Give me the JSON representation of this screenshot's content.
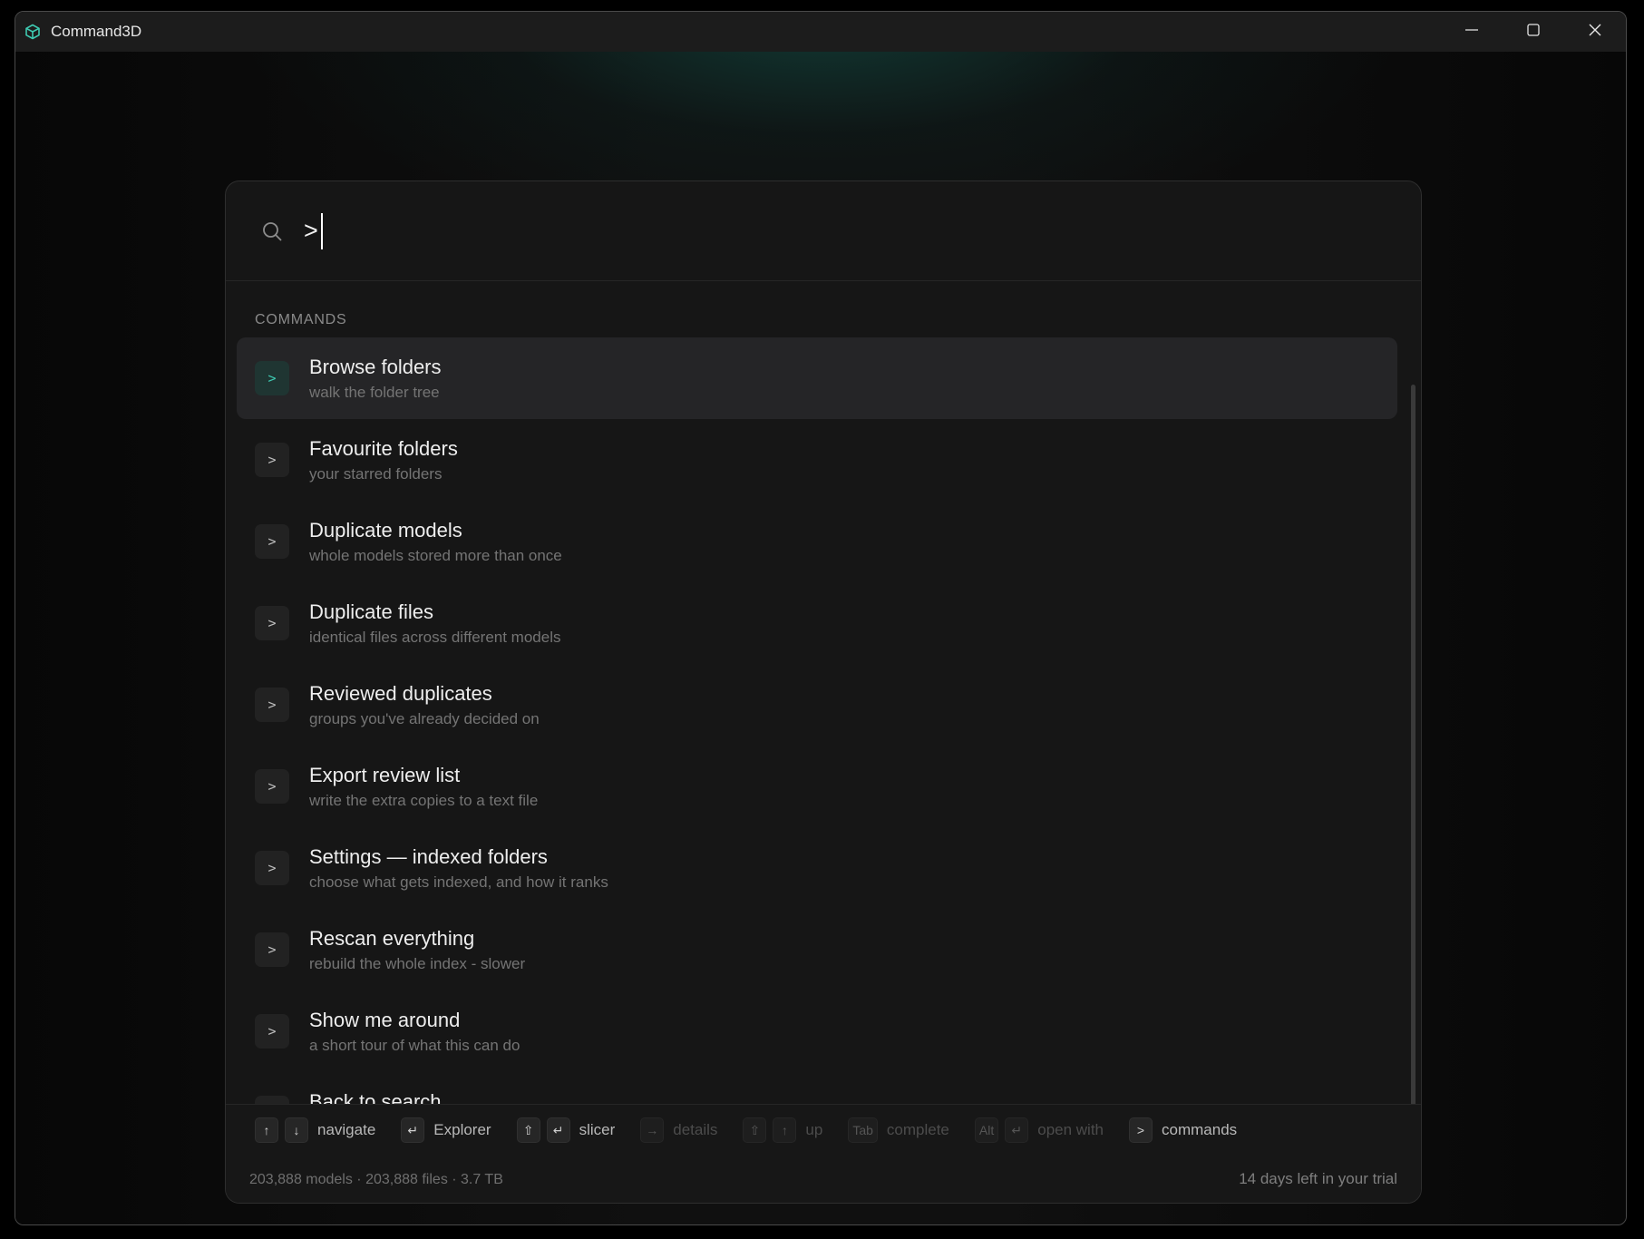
{
  "window": {
    "title": "Command3D",
    "app_icon": "cube-icon",
    "controls": [
      "minimize-icon",
      "maximize-icon",
      "close-icon"
    ],
    "accent_color": "#3ec9b1"
  },
  "search": {
    "value": ">",
    "icon": "search-icon"
  },
  "commands": {
    "section_label": "COMMANDS",
    "badge_glyph": ">",
    "items": [
      {
        "title": "Browse folders",
        "subtitle": "walk the folder tree",
        "active": true
      },
      {
        "title": "Favourite folders",
        "subtitle": "your starred folders"
      },
      {
        "title": "Duplicate models",
        "subtitle": "whole models stored more than once"
      },
      {
        "title": "Duplicate files",
        "subtitle": "identical files across different models"
      },
      {
        "title": "Reviewed duplicates",
        "subtitle": "groups you've already decided on"
      },
      {
        "title": "Export review list",
        "subtitle": "write the extra copies to a text file"
      },
      {
        "title": "Settings — indexed folders",
        "subtitle": "choose what gets indexed, and how it ranks"
      },
      {
        "title": "Rescan everything",
        "subtitle": "rebuild the whole index - slower"
      },
      {
        "title": "Show me around",
        "subtitle": "a short tour of what this can do"
      },
      {
        "title": "Back to search",
        "subtitle": ""
      }
    ]
  },
  "footer": {
    "hints": [
      {
        "keys": [
          "↑",
          "↓"
        ],
        "label": "navigate",
        "dim": false
      },
      {
        "keys": [
          "↵"
        ],
        "label": "Explorer",
        "dim": false
      },
      {
        "keys": [
          "⇧",
          "↵"
        ],
        "label": "slicer",
        "dim": false
      },
      {
        "keys": [
          "→"
        ],
        "label": "details",
        "dim": true
      },
      {
        "keys": [
          "⇧",
          "↑"
        ],
        "label": "up",
        "dim": true
      },
      {
        "keys": [
          "Tab"
        ],
        "label": "complete",
        "dim": true
      },
      {
        "keys": [
          "Alt",
          "↵"
        ],
        "label": "open with",
        "dim": true
      },
      {
        "keys": [
          ">"
        ],
        "label": "commands",
        "dim": false
      }
    ],
    "stats": "203,888 models · 203,888 files · 3.7 TB",
    "trial": "14 days left in your trial"
  }
}
